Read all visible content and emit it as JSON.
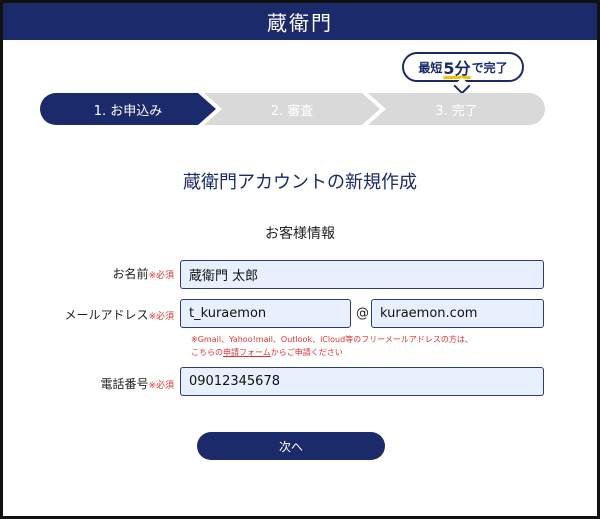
{
  "header": {
    "logo": "蔵衛門"
  },
  "badge": {
    "prefix": "最短",
    "highlight": "5分",
    "suffix": "で完了"
  },
  "steps": [
    {
      "label": "1. お申込み",
      "active": true
    },
    {
      "label": "2. 審査",
      "active": false
    },
    {
      "label": "3. 完了",
      "active": false
    }
  ],
  "page": {
    "title": "蔵衛門アカウントの新規作成",
    "section": "お客様情報"
  },
  "form": {
    "required_mark": "※必須",
    "name": {
      "label": "お名前",
      "value": "蔵衛門 太郎"
    },
    "email": {
      "label": "メールアドレス",
      "local": "t_kuraemon",
      "at": "@",
      "domain": "kuraemon.com"
    },
    "note": {
      "line1": "※Gmail、Yahoo!mail、Outlook、iCloud等のフリーメールアドレスの方は、",
      "line2_pre": "こちらの",
      "line2_link": "申請フォーム",
      "line2_post": "からご申請ください"
    },
    "phone": {
      "label": "電話番号",
      "value": "09012345678"
    }
  },
  "actions": {
    "next_label": "次へ"
  },
  "colors": {
    "primary": "#1b2a6b",
    "inactive_step": "#d9d9d9",
    "required": "#dd3333",
    "field_bg": "#e8f0fe"
  }
}
